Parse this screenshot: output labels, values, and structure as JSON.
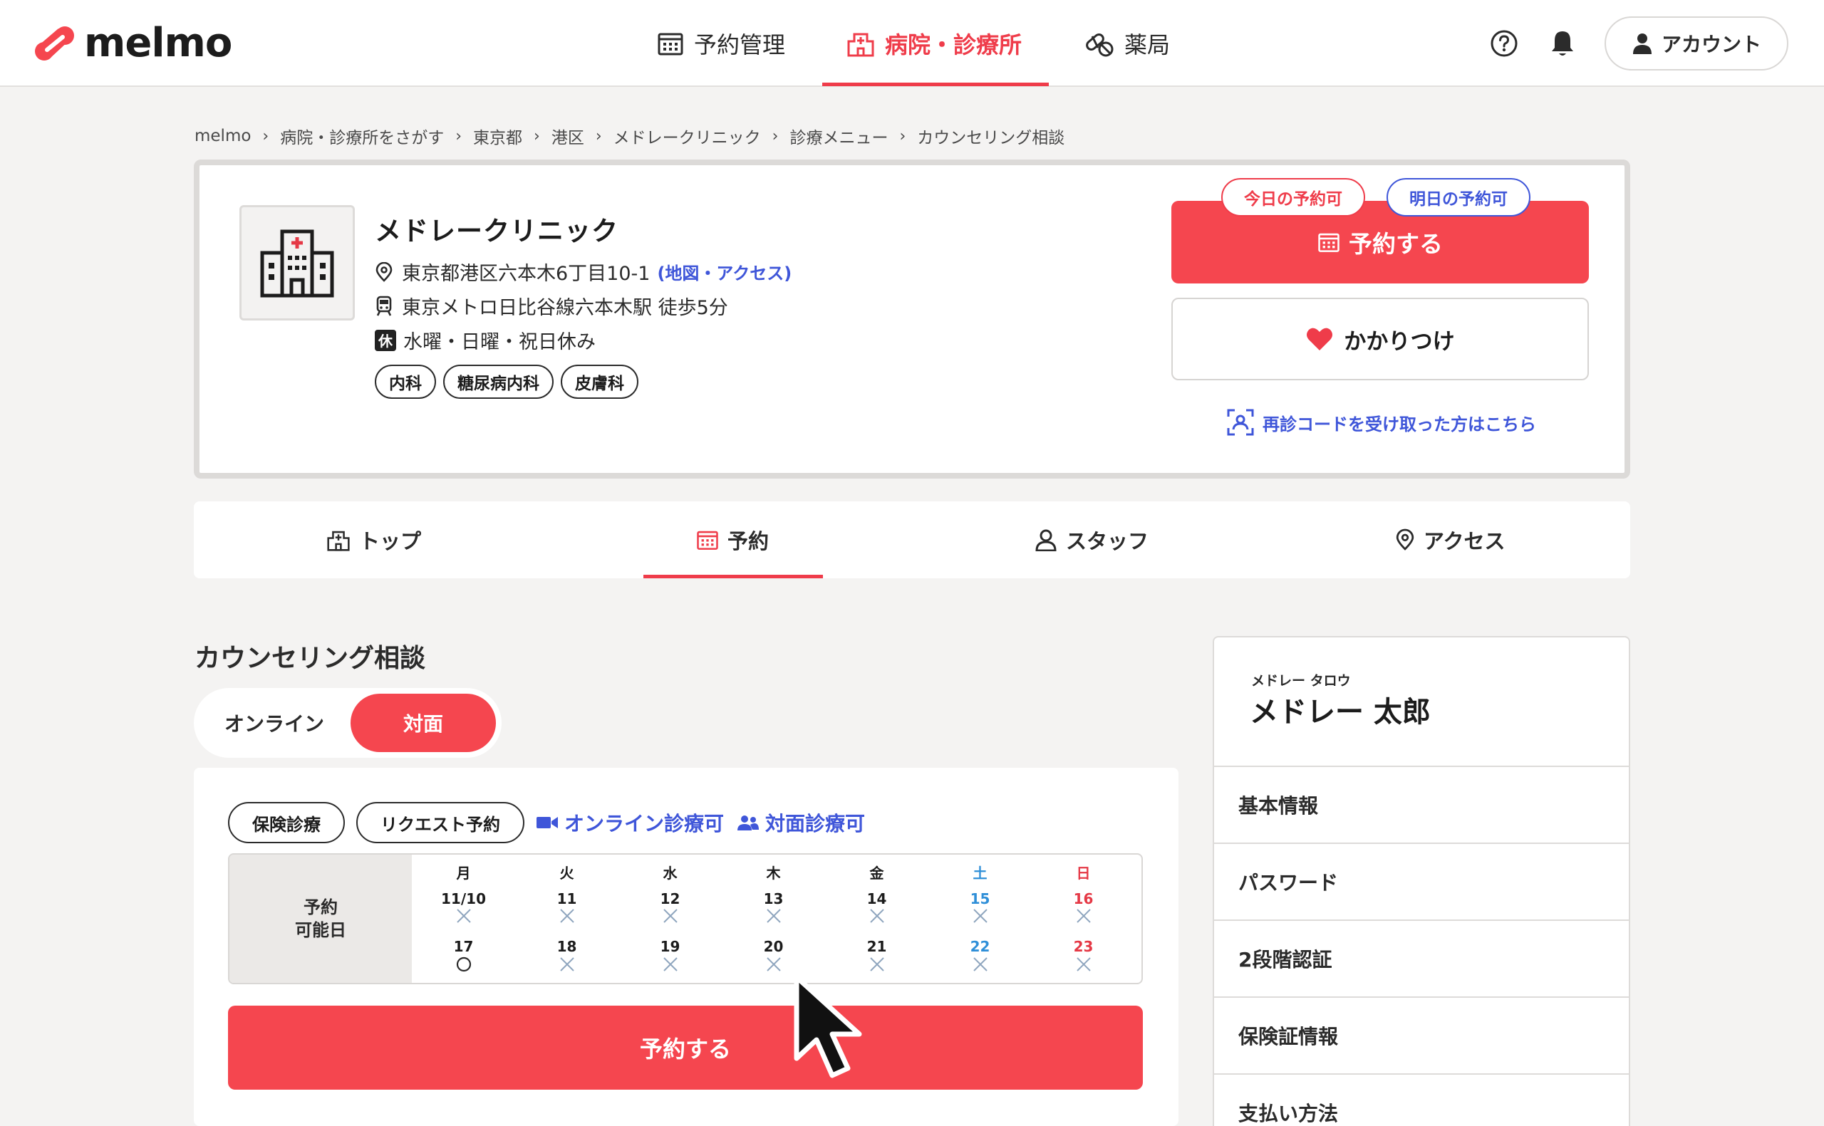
{
  "app": {
    "brand": "melmo",
    "accent_color": "#f5464f",
    "link_color": "#3f56d9"
  },
  "nav": {
    "items": [
      {
        "label": "予約管理",
        "icon": "calendar-icon",
        "active": false
      },
      {
        "label": "病院・診療所",
        "icon": "hospital-icon",
        "active": true
      },
      {
        "label": "薬局",
        "icon": "pill-icon",
        "active": false
      }
    ],
    "help_icon": "help-circle-icon",
    "bell_icon": "bell-icon",
    "account_label": "アカウント"
  },
  "breadcrumb": [
    "melmo",
    "病院・診療所をさがす",
    "東京都",
    "港区",
    "メドレークリニック",
    "診療メニュー",
    "カウンセリング相談"
  ],
  "clinic": {
    "name": "メドレークリニック",
    "address": "東京都港区六本木6丁目10-1",
    "map_link": "(地図・アクセス)",
    "station": "東京メトロ日比谷線六本木駅 徒歩5分",
    "closed_badge": "休",
    "closed_days": "水曜・日曜・祝日休み",
    "departments": [
      "内科",
      "糖尿病内科",
      "皮膚科"
    ],
    "badge_today": "今日の予約可",
    "badge_tomorrow": "明日の予約可",
    "reserve_label": "予約する",
    "favorite_label": "かかりつけ",
    "recode_link": "再診コードを受け取った方はこちら"
  },
  "tabs": [
    {
      "label": "トップ",
      "icon": "hospital-icon"
    },
    {
      "label": "予約",
      "icon": "calendar-icon",
      "active": true
    },
    {
      "label": "スタッフ",
      "icon": "person-icon"
    },
    {
      "label": "アクセス",
      "icon": "location-pin-icon"
    }
  ],
  "menu": {
    "title": "カウンセリング相談",
    "mode_online": "オンライン",
    "mode_inperson": "対面",
    "chips": [
      "保険診療",
      "リクエスト予約"
    ],
    "online_available": "オンライン診療可",
    "inperson_available": "対面診療可",
    "calendar": {
      "header": "予約\n可能日",
      "days": [
        {
          "dow": "月",
          "week1": "11/10",
          "mark1": "x",
          "week2": "17",
          "mark2": "o"
        },
        {
          "dow": "火",
          "week1": "11",
          "mark1": "x",
          "week2": "18",
          "mark2": "x"
        },
        {
          "dow": "水",
          "week1": "12",
          "mark1": "x",
          "week2": "19",
          "mark2": "x"
        },
        {
          "dow": "木",
          "week1": "13",
          "mark1": "x",
          "week2": "20",
          "mark2": "x"
        },
        {
          "dow": "金",
          "week1": "14",
          "mark1": "x",
          "week2": "21",
          "mark2": "x"
        },
        {
          "dow": "土",
          "week1": "15",
          "mark1": "x",
          "week2": "22",
          "mark2": "x",
          "kind": "sat"
        },
        {
          "dow": "日",
          "week1": "16",
          "mark1": "x",
          "week2": "23",
          "mark2": "x",
          "kind": "sun"
        }
      ]
    },
    "reserve_label": "予約する"
  },
  "user": {
    "ruby": "メドレー タロウ",
    "name": "メドレー 太郎",
    "menu": [
      "基本情報",
      "パスワード",
      "2段階認証",
      "保険証情報",
      "支払い方法"
    ]
  }
}
